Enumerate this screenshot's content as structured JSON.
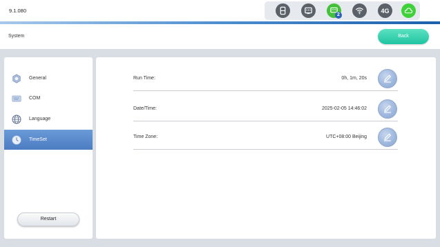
{
  "status_bar": {
    "version": "9.1.080",
    "icons": [
      {
        "name": "sim-card-icon"
      },
      {
        "name": "ethernet-icon"
      },
      {
        "name": "ethernet-status-icon",
        "badge": "2",
        "color": "#44c03b"
      },
      {
        "name": "wifi-icon"
      },
      {
        "name": "cellular-4g-icon",
        "text": "4G"
      },
      {
        "name": "cloud-icon",
        "color": "#3ed13a"
      }
    ]
  },
  "header": {
    "title": "System",
    "back_label": "Back"
  },
  "sidebar": {
    "items": [
      {
        "label": "General",
        "icon": "gear-icon"
      },
      {
        "label": "COM",
        "icon": "com-port-icon"
      },
      {
        "label": "Language",
        "icon": "globe-icon"
      },
      {
        "label": "TimeSet",
        "icon": "clock-icon",
        "active": true
      }
    ],
    "restart_label": "Restart"
  },
  "main": {
    "rows": [
      {
        "label": "Run Time:",
        "value": "0h, 1m, 20s"
      },
      {
        "label": "Date/Time:",
        "value": "2025-02-05 14:46:02"
      },
      {
        "label": "Time Zone:",
        "value": "UTC+08:00 Beijing"
      }
    ]
  },
  "colors": {
    "accent": "#1fc4a1",
    "active_nav": "#5a88cb",
    "status_green": "#44c03b"
  }
}
